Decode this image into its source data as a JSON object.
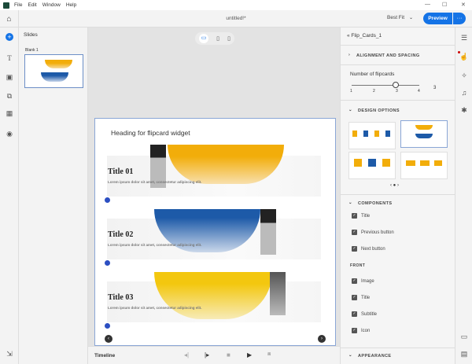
{
  "menu": {
    "items": [
      "File",
      "Edit",
      "Window",
      "Help"
    ]
  },
  "window_controls": {
    "minimize": "—",
    "maximize": "☐",
    "close": "✕"
  },
  "toolbar": {
    "title": "untitled!*",
    "zoom": "Best Fit",
    "preview": "Preview",
    "more": "···"
  },
  "slides_panel": {
    "title": "Slides",
    "slide_label": "Blank 1"
  },
  "slide": {
    "heading": "Heading for flipcard widget",
    "cards": [
      {
        "title": "Title 01",
        "subtitle": "Lorem ipsum dolor sit amet, consectetur adipiscing elit.",
        "color": "#f2ad0a"
      },
      {
        "title": "Title 02",
        "subtitle": "Lorem ipsum dolor sit amet, consectetur adipiscing elit.",
        "color": "#1d5aa8"
      },
      {
        "title": "Title 03",
        "subtitle": "Lorem ipsum dolor sit amet, consectetur adipiscing elit.",
        "color": "#f3c70f"
      }
    ]
  },
  "timeline": {
    "label": "Timeline"
  },
  "properties": {
    "widget_name": "Flip_Cards_1",
    "alignment": "ALIGNMENT AND SPACING",
    "flipcards_label": "Number of flipcards",
    "slider_ticks": [
      "1",
      "2",
      "3",
      "4"
    ],
    "flipcards_value": "3",
    "flipcards_selected": 3,
    "design_options": "DESIGN OPTIONS",
    "components": "COMPONENTS",
    "component_items": [
      {
        "label": "Title",
        "checked": true
      },
      {
        "label": "Previous button",
        "checked": true
      },
      {
        "label": "Next button",
        "checked": true
      }
    ],
    "front": "FRONT",
    "front_items": [
      {
        "label": "Image",
        "checked": true
      },
      {
        "label": "Title",
        "checked": true
      },
      {
        "label": "Subtitle",
        "checked": true
      },
      {
        "label": "Icon",
        "checked": true
      }
    ],
    "appearance": "APPEARANCE"
  },
  "accent": "#1473e6"
}
